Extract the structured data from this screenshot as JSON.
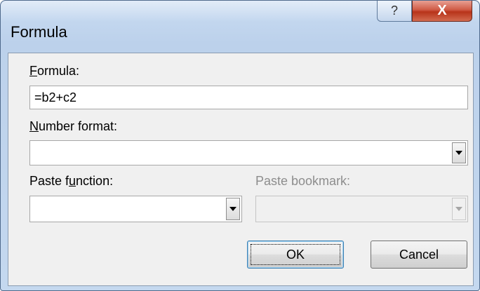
{
  "window": {
    "title": "Formula",
    "help_glyph": "?",
    "close_glyph": "X"
  },
  "formula": {
    "label_accel": "F",
    "label_rest": "ormula:",
    "value": "=b2+c2"
  },
  "number_format": {
    "label_accel": "N",
    "label_rest": "umber format:",
    "value": ""
  },
  "paste_function": {
    "label_pre": "Paste f",
    "label_accel": "u",
    "label_rest": "nction:",
    "value": ""
  },
  "paste_bookmark": {
    "label": "Paste bookmark:",
    "enabled": false
  },
  "buttons": {
    "ok": "OK",
    "cancel": "Cancel"
  }
}
